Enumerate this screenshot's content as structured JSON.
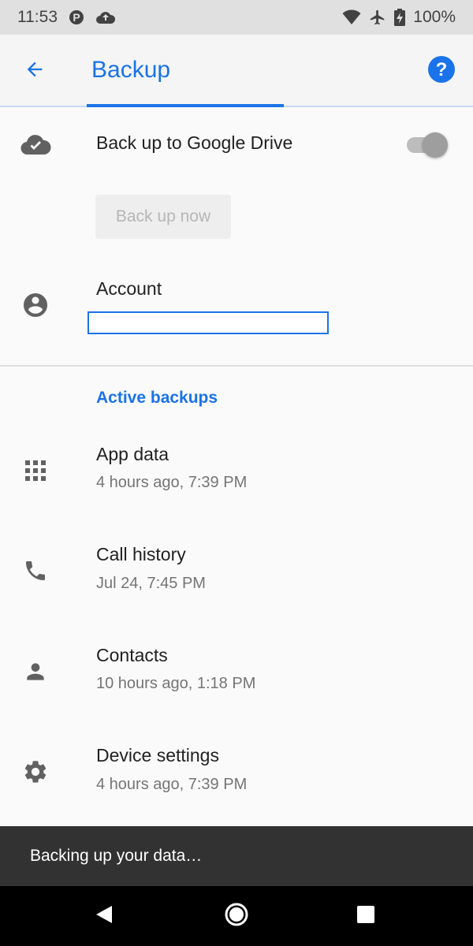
{
  "status_bar": {
    "time": "11:53",
    "battery": "100%",
    "left_icons": [
      "parking-notification-icon",
      "cloud-upload-icon"
    ],
    "right_icons": [
      "wifi-icon",
      "airplane-mode-icon",
      "battery-charging-icon"
    ]
  },
  "app_bar": {
    "title": "Backup",
    "back_icon": "arrow-back-icon",
    "help_icon": "help-icon",
    "accent_color": "#1a73e8"
  },
  "drive_backup": {
    "icon": "cloud-done-icon",
    "label": "Back up to Google Drive",
    "toggle_state": "off"
  },
  "backup_now": {
    "label": "Back up now",
    "enabled": false
  },
  "account": {
    "icon": "account-circle-icon",
    "label": "Account",
    "value": ""
  },
  "active_backups": {
    "header": "Active backups",
    "items": [
      {
        "icon": "apps-grid-icon",
        "title": "App data",
        "subtitle": "4 hours ago, 7:39 PM"
      },
      {
        "icon": "phone-icon",
        "title": "Call history",
        "subtitle": "Jul 24, 7:45 PM"
      },
      {
        "icon": "person-icon",
        "title": "Contacts",
        "subtitle": "10 hours ago, 1:18 PM"
      },
      {
        "icon": "gear-icon",
        "title": "Device settings",
        "subtitle": "4 hours ago, 7:39 PM"
      }
    ]
  },
  "snackbar": {
    "message": "Backing up your data…"
  },
  "nav_bar": {
    "buttons": [
      "back-triangle-icon",
      "home-circle-icon",
      "recents-square-icon"
    ]
  }
}
